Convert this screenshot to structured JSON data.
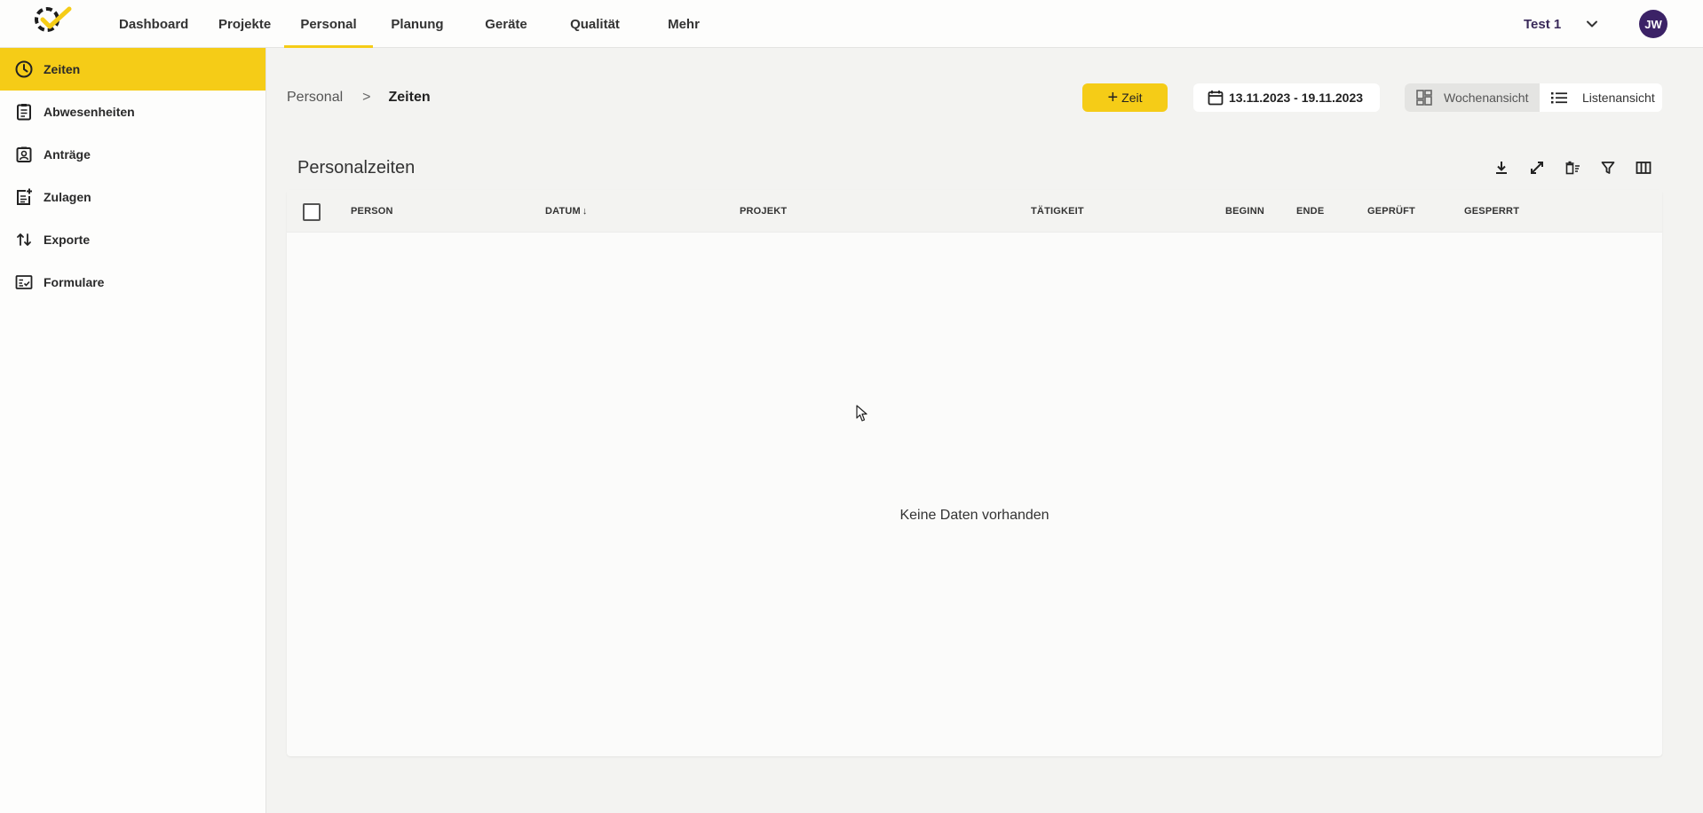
{
  "topnav": {
    "items": [
      {
        "label": "Dashboard",
        "width": 100
      },
      {
        "label": "Projekte",
        "width": 90
      },
      {
        "label": "Personal",
        "width": 100
      },
      {
        "label": "Planung",
        "width": 100
      },
      {
        "label": "Geräte",
        "width": 100
      },
      {
        "label": "Qualität",
        "width": 100
      },
      {
        "label": "Mehr",
        "width": 100
      }
    ],
    "active": "Personal",
    "tenant": "Test 1",
    "avatar_initials": "JW"
  },
  "sidebar": {
    "items": [
      {
        "label": "Zeiten",
        "icon": "clock-icon"
      },
      {
        "label": "Abwesenheiten",
        "icon": "clipboard-icon"
      },
      {
        "label": "Anträge",
        "icon": "badge-icon"
      },
      {
        "label": "Zulagen",
        "icon": "add-note-icon"
      },
      {
        "label": "Exporte",
        "icon": "swap-vertical-icon"
      },
      {
        "label": "Formulare",
        "icon": "checklist-icon"
      }
    ],
    "active": "Zeiten"
  },
  "breadcrumb": {
    "parent": "Personal",
    "separator": ">",
    "current": "Zeiten"
  },
  "actions": {
    "add_time_label": "Zeit",
    "date_range": "13.11.2023 - 19.11.2023",
    "week_view_label": "Wochenansicht",
    "list_view_label": "Listenansicht"
  },
  "table": {
    "title": "Personalzeiten",
    "columns": [
      "PERSON",
      "DATUM",
      "PROJEKT",
      "TÄTIGKEIT",
      "BEGINN",
      "ENDE",
      "GEPRÜFT",
      "GESPERRT"
    ],
    "sorted_column": "DATUM",
    "sort_direction": "desc",
    "empty_text": "Keine Daten vorhanden"
  },
  "colors": {
    "accent": "#f5cc17",
    "avatar": "#3b2266"
  }
}
